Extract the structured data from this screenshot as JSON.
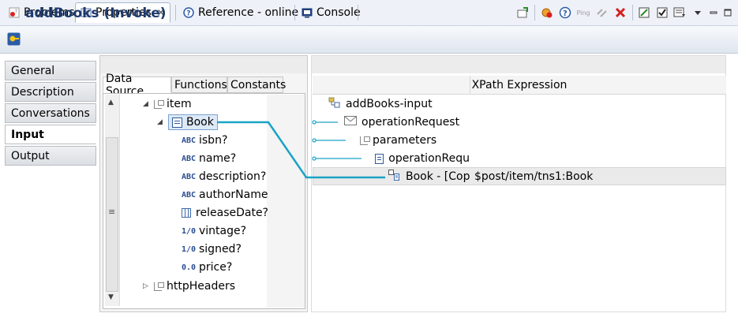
{
  "tabs": [
    {
      "label": "Problems",
      "icon": "problems-icon"
    },
    {
      "label": "Properties",
      "icon": "properties-icon",
      "active": true
    },
    {
      "label": "Reference - online",
      "icon": "help-icon"
    },
    {
      "label": "Console",
      "icon": "console-icon"
    }
  ],
  "title": "addBooks (Invoke)",
  "toolbar_ping": "Ping",
  "side_tabs": [
    "General",
    "Description",
    "Conversations",
    "Input",
    "Output"
  ],
  "selected_side_tab": "Input",
  "sub_tabs": [
    "Data Source",
    "Functions",
    "Constants"
  ],
  "tree": {
    "item": "item",
    "book": "Book",
    "fields": [
      {
        "type": "ABC",
        "label": "isbn?"
      },
      {
        "type": "ABC",
        "label": "name?"
      },
      {
        "type": "ABC",
        "label": "description?"
      },
      {
        "type": "ABC",
        "label": "authorName?"
      },
      {
        "type": "grid",
        "label": "releaseDate?"
      },
      {
        "type": "1/0",
        "label": "vintage?"
      },
      {
        "type": "1/0",
        "label": "signed?"
      },
      {
        "type": "0.0",
        "label": "price?"
      }
    ],
    "http_headers": "httpHeaders"
  },
  "scroll_handle": "≡",
  "xpath": {
    "header": "XPath Expression",
    "rows": [
      {
        "label": "addBooks-input",
        "value": ""
      },
      {
        "label": "operationRequest",
        "value": ""
      },
      {
        "label": "parameters",
        "value": ""
      },
      {
        "label": "operationRequ",
        "value": ""
      },
      {
        "label": "Book - [Cop",
        "value": "$post/item/tns1:Book"
      }
    ]
  },
  "colors": {
    "mapping_line": "#1ba3c6",
    "title_text": "#1d3a6e"
  }
}
